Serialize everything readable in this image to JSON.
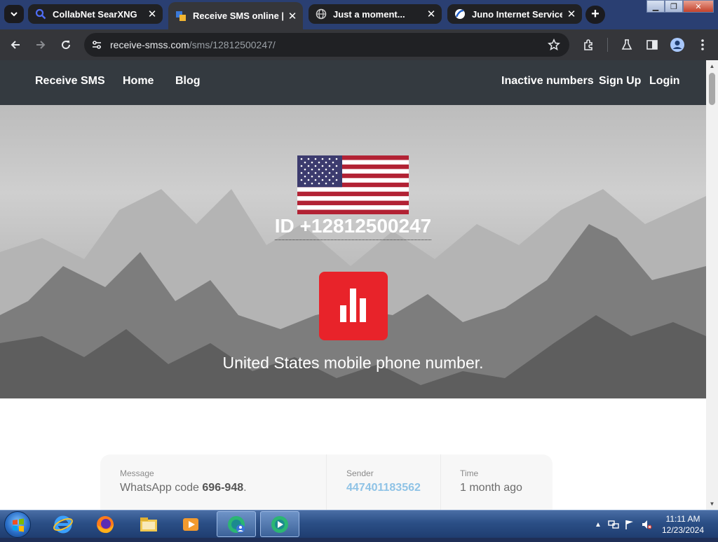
{
  "browser": {
    "tabs": [
      {
        "title": "CollabNet SearXNG",
        "favicon": "search-icon",
        "active": false
      },
      {
        "title": "Receive SMS online | Te",
        "favicon": "receive-sms-favicon",
        "active": true
      },
      {
        "title": "Just a moment...",
        "favicon": "globe-icon",
        "active": false
      },
      {
        "title": "Juno Internet Service- V",
        "favicon": "juno-favicon",
        "active": false
      }
    ],
    "address": {
      "domain": "receive-smss.com",
      "path": "/sms/12812500247/"
    }
  },
  "site": {
    "nav": {
      "brand": "Receive SMS",
      "home": "Home",
      "blog": "Blog",
      "inactive": "Inactive numbers",
      "signup": "Sign Up",
      "login": "Login"
    },
    "hero": {
      "id_text": "ID +12812500247",
      "subtitle": "United States mobile phone number.",
      "icon_color": "#e8232a"
    },
    "messages": {
      "headers": {
        "message": "Message",
        "sender": "Sender",
        "time": "Time"
      },
      "rows": [
        {
          "message_prefix": "WhatsApp code ",
          "code": "696-948",
          "message_suffix": ".",
          "sender": "447401183562",
          "time": "1 month ago"
        }
      ]
    }
  },
  "taskbar": {
    "apps": [
      "internet-explorer-icon",
      "firefox-icon",
      "file-explorer-icon",
      "media-player-icon",
      "chrome-app-icon",
      "chrome-app-icon"
    ],
    "clock": {
      "time": "11:11 AM",
      "date": "12/23/2024"
    }
  }
}
